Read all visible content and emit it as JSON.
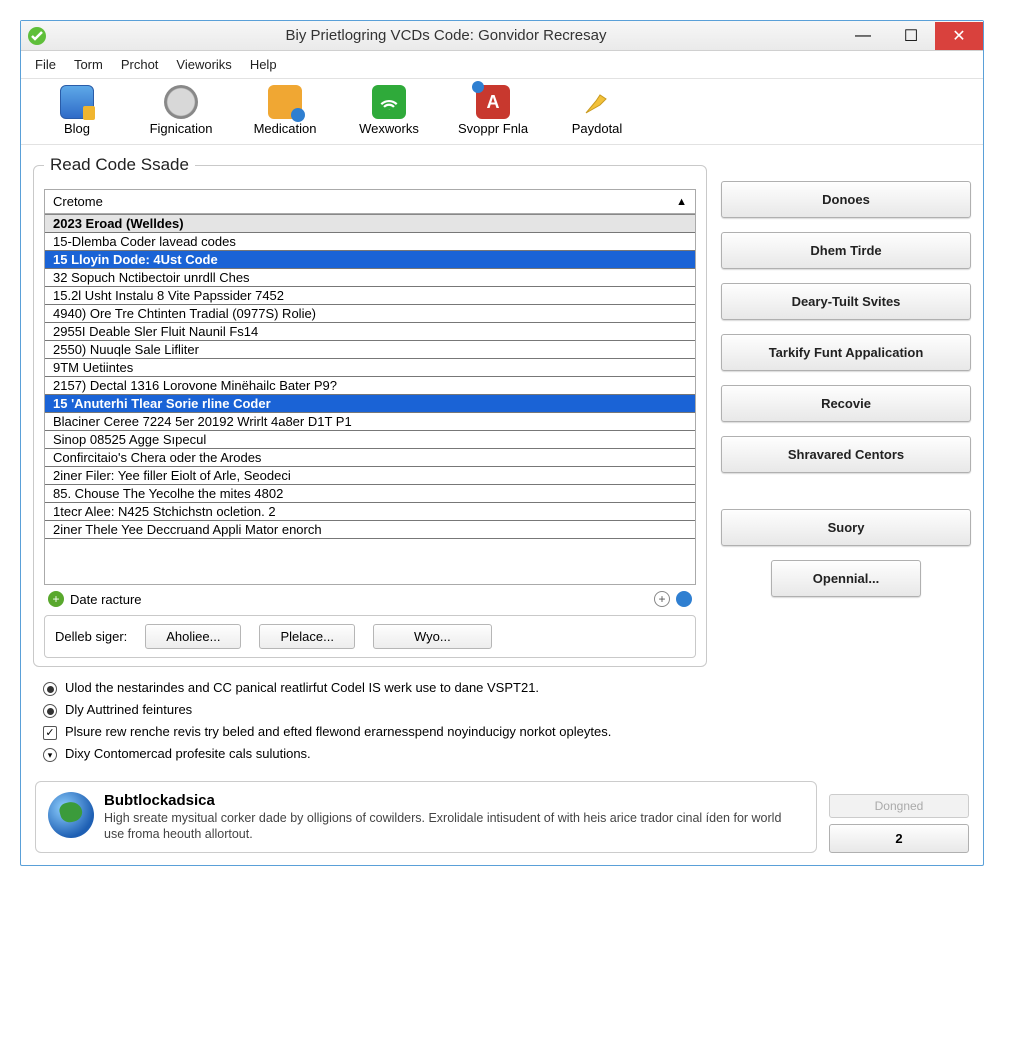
{
  "window": {
    "title": "Biy Prietlogring VCDs Code: Gonvidor Recresay"
  },
  "menu": {
    "file": "File",
    "torm": "Torm",
    "prchot": "Prchot",
    "vieworiks": "Vieworiks",
    "help": "Help"
  },
  "toolbar": {
    "blog": "Blog",
    "fignication": "Fignication",
    "medication": "Medication",
    "wexworks": "Wexworks",
    "svoppr": "Svoppr Fnla",
    "paydotal": "Paydotal"
  },
  "panel": {
    "legend": "Read Code Ssade",
    "header": "Cretome"
  },
  "rows": [
    "2023 Eroad (Welldes)",
    "15-Dlemba Coder lavead codes",
    "15 Lloyin Dode:  4Ust Code",
    "32 Sopuch Nctibectoir unrdll Ches",
    "15.2l Usht Instalu 8 Vite Papssider 7452",
    "4940) Ore Tre Chtinten  Tradial (0977S) Rolie)",
    "2955I Deable Sler Fluit Naunil Fs14",
    "2550) Nuuqle Sale Lifliter",
    "9TM Uetiintes",
    "2157) Dectal 1316 Lorovone Minëhailc Bater P9?",
    "15 'Anuterhi Tlear Sorie rline Coder",
    "Blaciner Ceree 7224 5er 20192 Wrirlt 4a8er D1T P1",
    "Sinop 08525 Agge Sıpecul",
    "Confircitaio's Chera oder the Arodes",
    "2iner Filer: Yee filler Eiolt of Arle, Seodeci",
    "85. Chouse The Yecolhe the mites 4802",
    "1tecr Alee: N425 Stchichstn ocletion. 2",
    "2iner Thele Yee Deccruand Appli Mator enorch"
  ],
  "date_label": "Date racture",
  "buttons_below": {
    "label": "Delleb siger:",
    "b1": "Aholiee...",
    "b2": "Plelace...",
    "b3": "Wyo..."
  },
  "side": {
    "b1": "Donoes",
    "b2": "Dhem Tirde",
    "b3": "Deary-Tuilt Svites",
    "b4": "Tarkify Funt Appalication",
    "b5": "Recovie",
    "b6": "Shravared Centors",
    "b7": "Suory",
    "b8": "Opennial..."
  },
  "options": {
    "o1": "Ulod the nestarindes and CC panical reatlirfut Codel IS werk use to dane VSPT21.",
    "o2": "Dly Auttrined feintures",
    "o3": "Plsure rew renche revis try beled and efted flewond erarnesspend noyinducigy norkot opleytes.",
    "o4": "Dixy Contomercad profesite cals sulutions."
  },
  "banner": {
    "title": "Bubtlockadsica",
    "body": "High sreate mysitual corker dade by olligions of cowilders. Exrolidale intisudent of with heis arice trador cinal íden for world use froma heouth allortout."
  },
  "bottom_right": {
    "disabled": "Dongned",
    "num": "2"
  }
}
